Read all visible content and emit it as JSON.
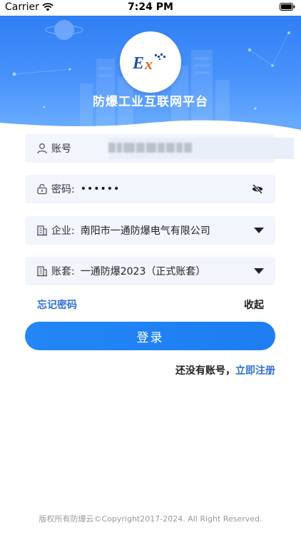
{
  "status_bar": {
    "carrier": "Carrier",
    "time": "7:24 PM"
  },
  "header": {
    "logo_text": "Ex",
    "title": "防爆工业互联网平台"
  },
  "form": {
    "account": {
      "label": "账号",
      "value": ""
    },
    "password": {
      "label": "密码:",
      "value": "••••••"
    },
    "company": {
      "label": "企业:",
      "value": "南阳市一通防爆电气有限公司"
    },
    "ledger": {
      "label": "账套:",
      "value": "一通防爆2023（正式账套）"
    }
  },
  "links": {
    "forgot_password": "忘记密码",
    "collapse": "收起"
  },
  "login_button": "登录",
  "register": {
    "prompt": "还没有账号，",
    "link": "立即注册"
  },
  "footer": "版权所有防爆云©Copyright2017-2024. All Right Reserved.",
  "colors": {
    "brand_blue": "#2286f6",
    "link_blue": "#2f6fdc",
    "field_bg": "#f2f5fb"
  },
  "icons": {
    "account": "user-icon",
    "password": "lock-icon",
    "eye": "eye-off-icon",
    "company": "building-icon",
    "ledger": "building-icon"
  }
}
